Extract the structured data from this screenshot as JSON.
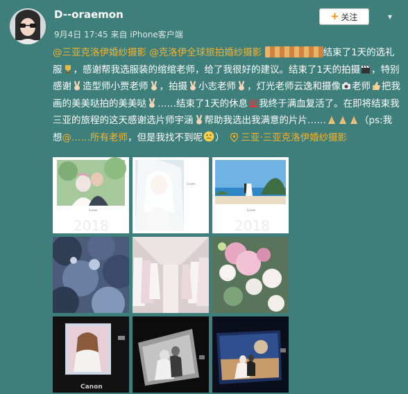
{
  "user": {
    "name": "D--oraemon",
    "meta": "9月4日 17:45 来自 iPhone客户端",
    "follow_label": "关注"
  },
  "post": {
    "mention1": "@三亚克洛伊婚纱摄影",
    "mention2": "@克洛伊全球旅拍婚纱摄影",
    "t1": "结束了1天的选礼服",
    "t2": "，感谢帮我选服装的绾绾老师，给了我很好的建议。结束了1天的拍摄",
    "t3": "，特别感谢",
    "t4": "造型师小贾老师",
    "t5": "，拍摄",
    "t6": "小志老师",
    "t7": "，灯光老师云逸和摄像",
    "t8": "老师",
    "t9": "把我画的美美哒拍的美美哒",
    "t10": "……结束了1天的休息",
    "t11": "我终于满血复活了。在即将结束我三亚的旅程的这天感谢选片师宇涵",
    "t12": "帮助我选出我满意的片片……",
    "t13": "（ps:我想",
    "mention3": "@……所有老师",
    "t14": "，但是我找不到呢",
    "t15": "）",
    "location": "三亚·三亚克洛伊婚纱摄影"
  },
  "photos": [
    {
      "caption": "2018",
      "desc": "wedding-couple-flowers"
    },
    {
      "caption": "2018",
      "desc": "bride-veil-portrait"
    },
    {
      "caption": "2018",
      "desc": "couple-on-beach"
    },
    {
      "desc": "tree-canopy-sky"
    },
    {
      "desc": "dress-showroom-corridor"
    },
    {
      "desc": "pink-flower-bouquet"
    },
    {
      "caption": "Canon",
      "desc": "camera-screen-portrait"
    },
    {
      "desc": "camera-screen-couple-bw"
    },
    {
      "desc": "camera-screen-night"
    }
  ],
  "colors": {
    "background": "#3f7f7b",
    "link": "#f5b32c",
    "follow_plus": "#ff8200"
  }
}
